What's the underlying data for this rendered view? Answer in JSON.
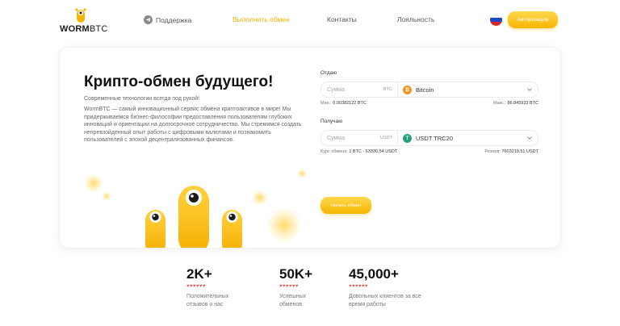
{
  "header": {
    "logo": {
      "brand": "WORM",
      "brand_accent": "BTC"
    },
    "nav": {
      "support": "Поддержка",
      "exchange": "Выполнить обмен",
      "contacts": "Контакты",
      "loyalty": "Лояльность"
    },
    "language_flag": "ru-flag",
    "auth_button": "Авторизация",
    "accent_color": "#F7B500"
  },
  "hero": {
    "title": "Крипто-обмен будущего!",
    "subtitle": "Современные технологии всегда под рукой!",
    "description": "WormBTC — самый инновационный сервис обмена криптоактивов в мире! Мы придерживаемся бизнес-философии предоставления пользователям глубоких инноваций и ориентации на долгосрочное сотрудничество. Мы стремимся создать непревзойденный опыт работы с цифровыми валютами и познакомить пользователей с эпохой децентрализованных финансов."
  },
  "exchange": {
    "give": {
      "label": "Отдаю",
      "amount_placeholder": "Сумма",
      "currency_code": "BTC",
      "coin_name": "Bitcoin",
      "coin_icon": "bitcoin-icon",
      "coin_color": "#F7931A",
      "min_label": "Мин.:",
      "min_value": "0.00382122 BTC",
      "max_label": "Макс.:",
      "max_value": "86.845933 BTC"
    },
    "receive": {
      "label": "Получаю",
      "amount_placeholder": "Сумма",
      "currency_code": "USDT",
      "coin_name": "USDT TRC20",
      "coin_icon": "tether-icon",
      "coin_color": "#26A17B",
      "rate_label": "Курс обмена:",
      "rate_value": "1 BTC - 63330.54 USDT",
      "reserve_label": "Резерв:",
      "reserve_value": "7603219.51 USDT"
    },
    "submit_button": "Начать обмен"
  },
  "stats": [
    {
      "value": "2K+",
      "hearts": "♥♥♥♥♥♥",
      "desc_line1": "Положительных",
      "desc_line2": "отзывов о нас"
    },
    {
      "value": "50K+",
      "hearts": "♥♥♥♥♥♥",
      "desc_line1": "Успешных",
      "desc_line2": "обменов"
    },
    {
      "value": "45,000+",
      "hearts": "♥♥♥♥♥♥",
      "desc_line1": "Довольных клиентов за все",
      "desc_line2": "время работы"
    }
  ]
}
